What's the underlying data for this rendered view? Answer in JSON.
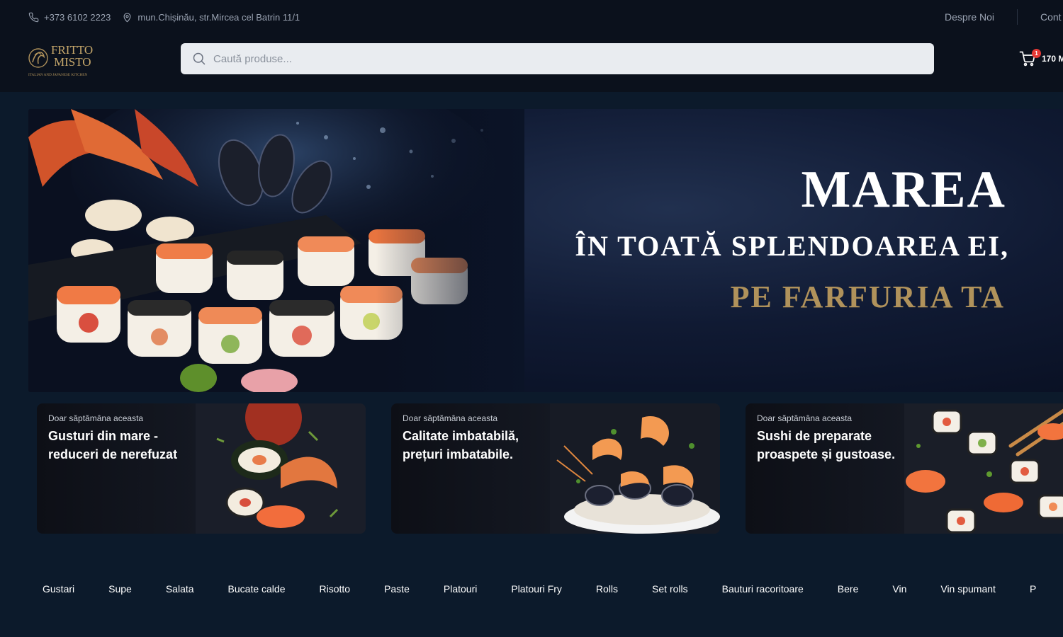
{
  "topbar": {
    "phone": "+373 6102 2223",
    "address": "mun.Chișinău, str.Mircea cel Batrin 11/1"
  },
  "topnav": {
    "items": [
      "Despre Noi",
      "Cont"
    ]
  },
  "logo": {
    "line1": "FRITTO",
    "line2": "MISTO",
    "tagline": "ITALIAN AND JAPANESE KITCHEN"
  },
  "search": {
    "placeholder": "Caută produse..."
  },
  "cart": {
    "count": "1",
    "total": "170 M"
  },
  "hero": {
    "title": "MAREA",
    "line2": "ÎN TOATĂ SPLENDOAREA EI,",
    "line3": "PE FARFURIA TA"
  },
  "promos": [
    {
      "eyebrow": "Doar săptămâna aceasta",
      "title": "Gusturi din mare - reduceri de nerefuzat"
    },
    {
      "eyebrow": "Doar săptămâna aceasta",
      "title": "Calitate imbatabilă, prețuri imbatabile."
    },
    {
      "eyebrow": "Doar săptămâna aceasta",
      "title": "Sushi de preparate proaspete și gustoase."
    }
  ],
  "categories": [
    "Gustari",
    "Supe",
    "Salata",
    "Bucate calde",
    "Risotto",
    "Paste",
    "Platouri",
    "Platouri Fry",
    "Rolls",
    "Set rolls",
    "Bauturi racoritoare",
    "Bere",
    "Vin",
    "Vin spumant",
    "P"
  ],
  "colors": {
    "page_bg": "#0c1a2b",
    "header_bg": "#0b111c",
    "gold": "#b0925b",
    "badge": "#e53935"
  }
}
